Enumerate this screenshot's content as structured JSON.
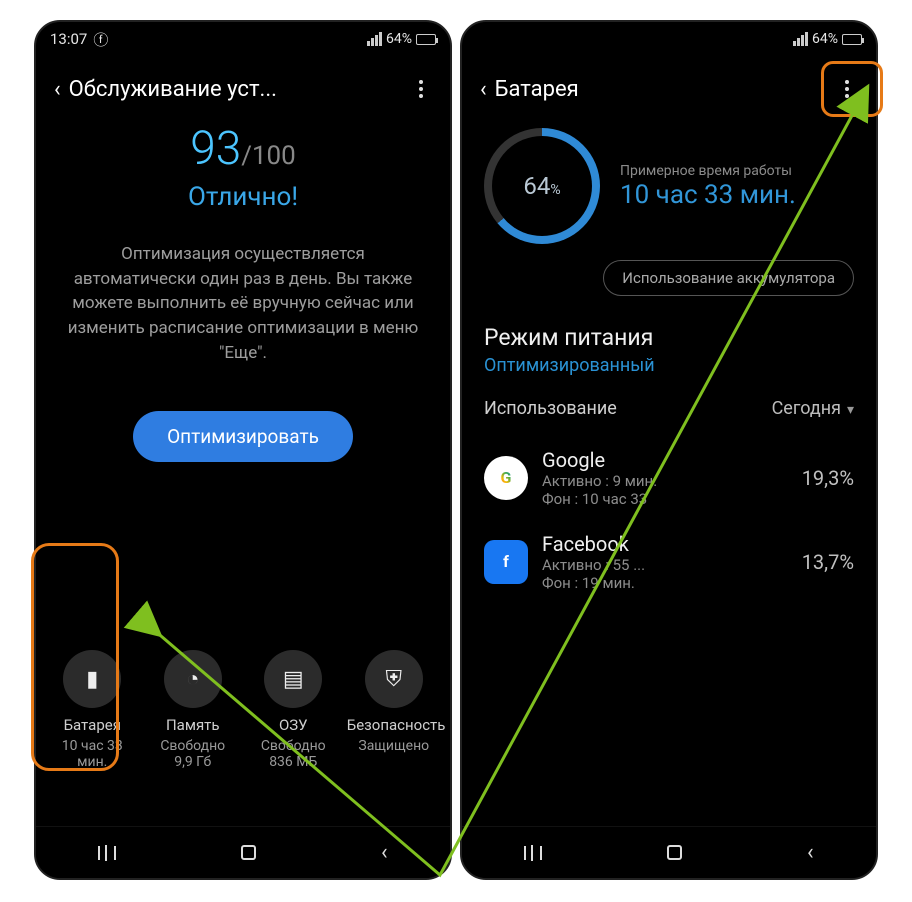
{
  "status": {
    "time": "13:07",
    "battery": "64%"
  },
  "left": {
    "title": "Обслуживание уст...",
    "score": "93",
    "scoreMax": "/100",
    "statusWord": "Отлично!",
    "desc": "Оптимизация осуществляется автоматически один раз в день. Вы также можете выполнить её вручную сейчас или изменить расписание оптимизации в меню \"Еще\".",
    "optimize": "Оптимизировать",
    "tiles": [
      {
        "label": "Батарея",
        "sub1": "10 час 33",
        "sub2": "мин."
      },
      {
        "label": "Память",
        "sub1": "Свободно",
        "sub2": "9,9 Гб"
      },
      {
        "label": "ОЗУ",
        "sub1": "Свободно",
        "sub2": "836 МБ"
      },
      {
        "label": "Безопасность",
        "sub1": "Защищено",
        "sub2": ""
      }
    ]
  },
  "right": {
    "title": "Батарея",
    "ringPercent": "64",
    "ringSuffix": "%",
    "caption": "Примерное время работы",
    "time": "10 час 33 мин.",
    "usageBtn": "Использование аккумулятора",
    "modeTitle": "Режим питания",
    "modeValue": "Оптимизированный",
    "usageLabel": "Использование",
    "usagePeriod": "Сегодня",
    "apps": [
      {
        "name": "Google",
        "active": "Активно : 9 мин.",
        "bg": "Фон : 10 час 33",
        "pct": "19,3%",
        "icon": "G"
      },
      {
        "name": "Facebook",
        "active": "Активно : 55 ...",
        "bg": "Фон : 19 мин.",
        "pct": "13,7%",
        "icon": "f"
      }
    ]
  }
}
